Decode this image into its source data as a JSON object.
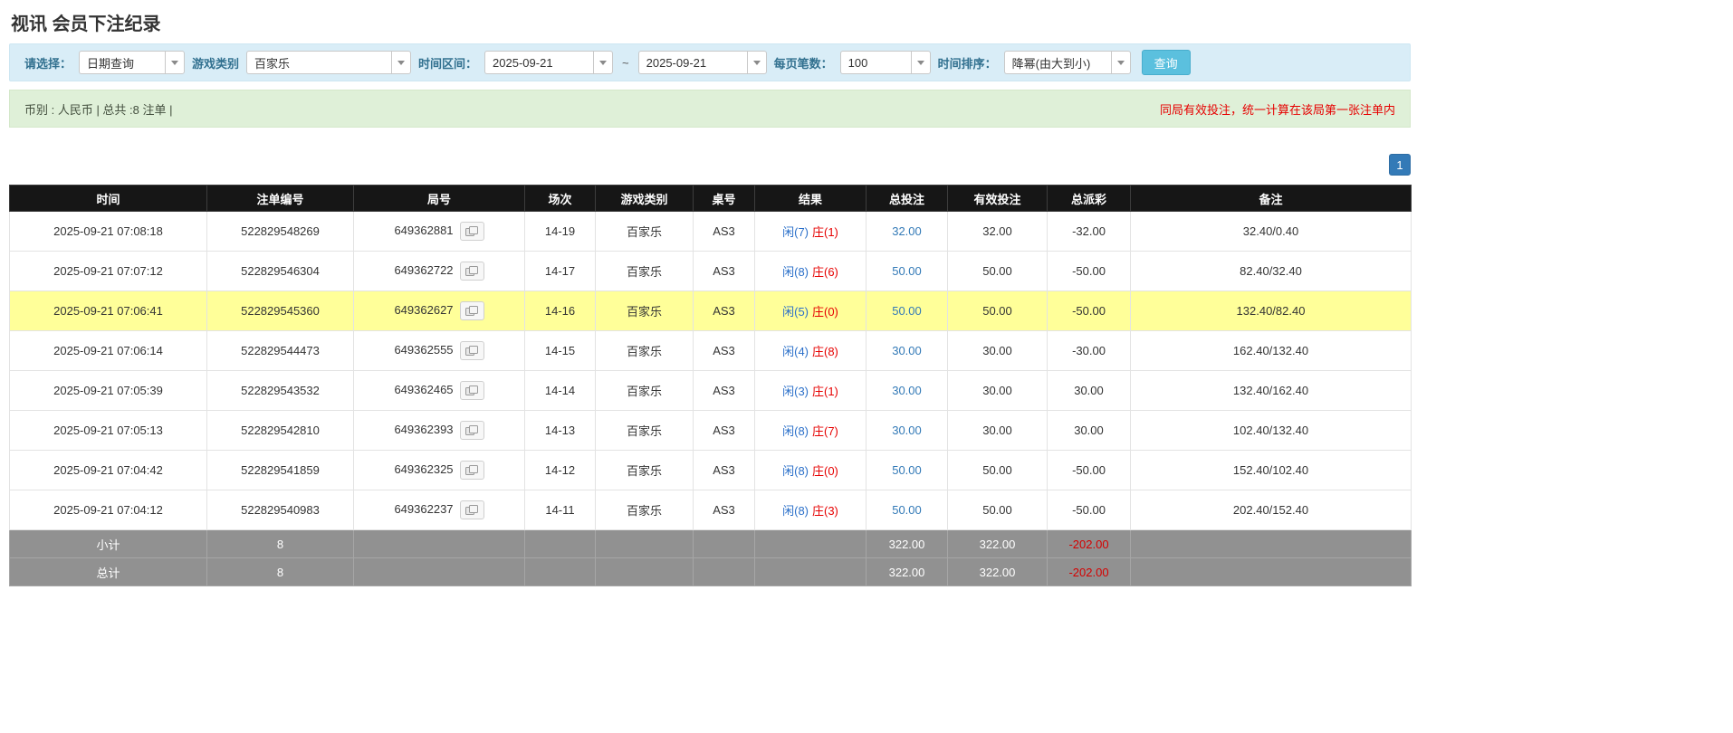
{
  "page_title": "视讯 会员下注纪录",
  "colors": {
    "link_blue": "#337ab7",
    "negative_red": "#e60000",
    "player_blue": "#2a6fc9",
    "banker_red": "#e60000",
    "highlight_yellow": "#ffff99",
    "filter_bar_bg": "#d9edf7",
    "summary_bar_bg": "#dff0d8",
    "table_header_bg": "#161616",
    "footer_row_bg": "#919191",
    "query_button_bg": "#5bc0de"
  },
  "filters": {
    "select_label": "请选择：",
    "select_value": "日期查询",
    "game_label": "游戏类别",
    "game_value": "百家乐",
    "range_label": "时间区间：",
    "date_from": "2025-09-21",
    "range_separator": "~",
    "date_to": "2025-09-21",
    "page_size_label": "每页笔数：",
    "page_size_value": "100",
    "sort_label": "时间排序：",
    "sort_value": "降幂(由大到小)",
    "query_button_label": "查询"
  },
  "summary": {
    "left_text": "币别 : 人民币 | 总共 :8 注单 |",
    "right_text": "同局有效投注，统一计算在该局第一张注单内"
  },
  "pagination": {
    "current_page": "1"
  },
  "table": {
    "headers": {
      "time": "时间",
      "bet_id": "注单编号",
      "round": "局号",
      "session": "场次",
      "game": "游戏类别",
      "table_no": "桌号",
      "result": "结果",
      "total_bet": "总投注",
      "valid_bet": "有效投注",
      "payout": "总派彩",
      "remark": "备注"
    },
    "rows": [
      {
        "time": "2025-09-21 07:08:18",
        "bet_id": "522829548269",
        "round": "649362881",
        "session": "14-19",
        "game": "百家乐",
        "table_no": "AS3",
        "result_player": "闲(7)",
        "result_banker": "庄(1)",
        "total_bet": "32.00",
        "valid_bet": "32.00",
        "payout": "-32.00",
        "remark": "32.40/0.40"
      },
      {
        "time": "2025-09-21 07:07:12",
        "bet_id": "522829546304",
        "round": "649362722",
        "session": "14-17",
        "game": "百家乐",
        "table_no": "AS3",
        "result_player": "闲(8)",
        "result_banker": "庄(6)",
        "total_bet": "50.00",
        "valid_bet": "50.00",
        "payout": "-50.00",
        "remark": "82.40/32.40"
      },
      {
        "time": "2025-09-21 07:06:41",
        "bet_id": "522829545360",
        "round": "649362627",
        "session": "14-16",
        "game": "百家乐",
        "table_no": "AS3",
        "result_player": "闲(5)",
        "result_banker": "庄(0)",
        "total_bet": "50.00",
        "valid_bet": "50.00",
        "payout": "-50.00",
        "remark": "132.40/82.40"
      },
      {
        "time": "2025-09-21 07:06:14",
        "bet_id": "522829544473",
        "round": "649362555",
        "session": "14-15",
        "game": "百家乐",
        "table_no": "AS3",
        "result_player": "闲(4)",
        "result_banker": "庄(8)",
        "total_bet": "30.00",
        "valid_bet": "30.00",
        "payout": "-30.00",
        "remark": "162.40/132.40"
      },
      {
        "time": "2025-09-21 07:05:39",
        "bet_id": "522829543532",
        "round": "649362465",
        "session": "14-14",
        "game": "百家乐",
        "table_no": "AS3",
        "result_player": "闲(3)",
        "result_banker": "庄(1)",
        "total_bet": "30.00",
        "valid_bet": "30.00",
        "payout": "30.00",
        "remark": "132.40/162.40"
      },
      {
        "time": "2025-09-21 07:05:13",
        "bet_id": "522829542810",
        "round": "649362393",
        "session": "14-13",
        "game": "百家乐",
        "table_no": "AS3",
        "result_player": "闲(8)",
        "result_banker": "庄(7)",
        "total_bet": "30.00",
        "valid_bet": "30.00",
        "payout": "30.00",
        "remark": "102.40/132.40"
      },
      {
        "time": "2025-09-21 07:04:42",
        "bet_id": "522829541859",
        "round": "649362325",
        "session": "14-12",
        "game": "百家乐",
        "table_no": "AS3",
        "result_player": "闲(8)",
        "result_banker": "庄(0)",
        "total_bet": "50.00",
        "valid_bet": "50.00",
        "payout": "-50.00",
        "remark": "152.40/102.40"
      },
      {
        "time": "2025-09-21 07:04:12",
        "bet_id": "522829540983",
        "round": "649362237",
        "session": "14-11",
        "game": "百家乐",
        "table_no": "AS3",
        "result_player": "闲(8)",
        "result_banker": "庄(3)",
        "total_bet": "50.00",
        "valid_bet": "50.00",
        "payout": "-50.00",
        "remark": "202.40/152.40"
      }
    ],
    "subtotal": {
      "label": "小计",
      "count": "8",
      "total_bet": "322.00",
      "valid_bet": "322.00",
      "payout": "-202.00"
    },
    "total": {
      "label": "总计",
      "count": "8",
      "total_bet": "322.00",
      "valid_bet": "322.00",
      "payout": "-202.00"
    }
  }
}
